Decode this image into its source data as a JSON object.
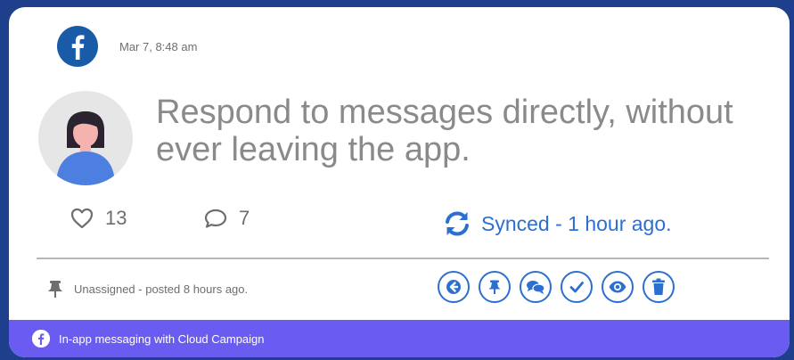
{
  "post": {
    "network_icon": "facebook-icon",
    "timestamp": "Mar 7, 8:48 am",
    "message": "Respond to messages directly, without ever leaving the app.",
    "avatar_icon": "user-avatar"
  },
  "stats": {
    "likes": "13",
    "comments": "7"
  },
  "sync": {
    "status_text": "Synced - 1 hour ago."
  },
  "assignment": {
    "text": "Unassigned - posted 8 hours ago."
  },
  "actions": [
    {
      "name": "reply-icon"
    },
    {
      "name": "pin-icon"
    },
    {
      "name": "chat-icon"
    },
    {
      "name": "check-icon"
    },
    {
      "name": "view-icon"
    },
    {
      "name": "delete-icon"
    }
  ],
  "footer": {
    "text": "In-app messaging with Cloud Campaign"
  },
  "colors": {
    "background": "#1d3f8c",
    "accent": "#2c6fd1",
    "facebook": "#1a5ba8",
    "footer": "#6a5cf0",
    "muted_text": "#8a8a8a"
  }
}
